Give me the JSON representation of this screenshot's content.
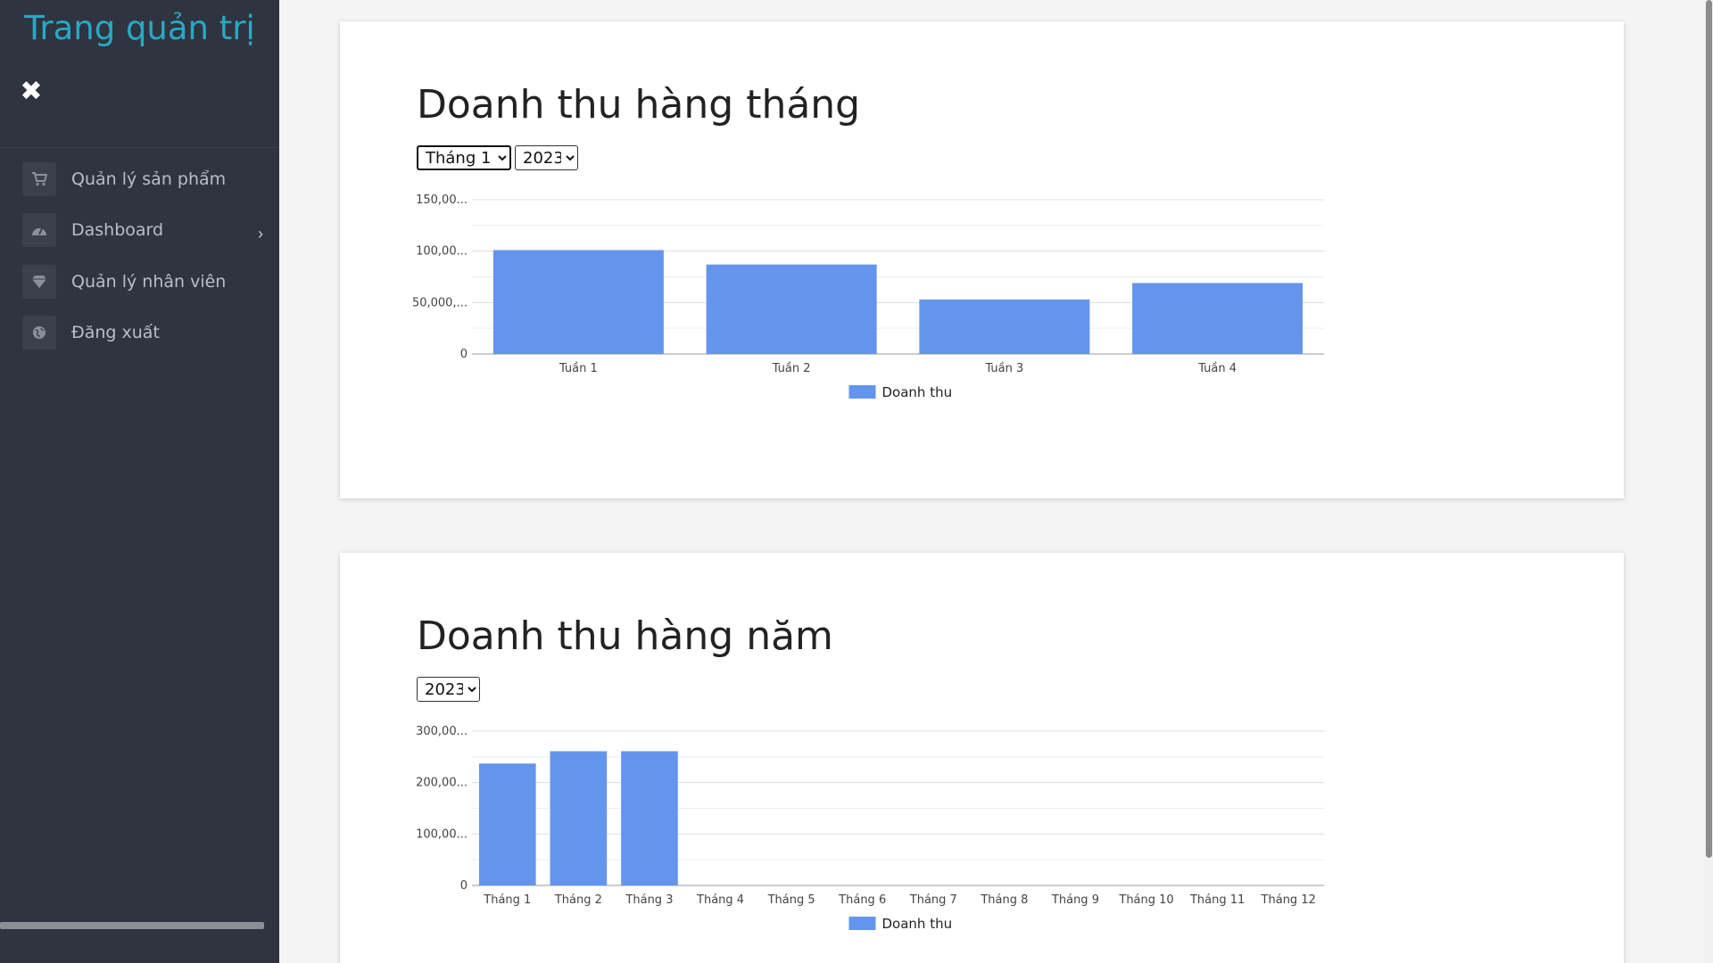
{
  "sidebar": {
    "brand": "Trang quản trị",
    "items": [
      {
        "label": "Quản lý sản phẩm",
        "icon": "cart-icon"
      },
      {
        "label": "Dashboard",
        "icon": "dashboard-icon"
      },
      {
        "label": "Quản lý nhân viên",
        "icon": "diamond-icon"
      },
      {
        "label": "Đăng xuất",
        "icon": "globe-icon"
      }
    ]
  },
  "monthly": {
    "title": "Doanh thu hàng tháng",
    "month_selected": "Tháng 1",
    "year_selected": "2023"
  },
  "yearly": {
    "title": "Doanh thu hàng năm",
    "year_selected": "2023"
  },
  "chart_data": [
    {
      "type": "bar",
      "categories": [
        "Tuần 1",
        "Tuần 2",
        "Tuần 3",
        "Tuần 4"
      ],
      "series": [
        {
          "name": "Doanh thu",
          "values": [
            101000,
            87000,
            53000,
            69000
          ],
          "color": "#6495ed"
        }
      ],
      "ytick_labels": [
        "0",
        "50,000,...",
        "100,00...",
        "150,00..."
      ],
      "ylim": [
        0,
        150000
      ],
      "legend": "bottom",
      "grid": true
    },
    {
      "type": "bar",
      "categories": [
        "Tháng 1",
        "Tháng 2",
        "Tháng 3",
        "Tháng 4",
        "Tháng 5",
        "Tháng 6",
        "Tháng 7",
        "Tháng 8",
        "Tháng 9",
        "Tháng 10",
        "Tháng 11",
        "Tháng 12"
      ],
      "series": [
        {
          "name": "Doanh thu",
          "values": [
            237000,
            261000,
            261000,
            0,
            0,
            0,
            0,
            0,
            0,
            0,
            0,
            0
          ],
          "color": "#6495ed"
        }
      ],
      "ytick_labels": [
        "0",
        "100,00...",
        "200,00...",
        "300,00..."
      ],
      "ylim": [
        0,
        300000
      ],
      "legend": "bottom",
      "grid": true
    }
  ]
}
